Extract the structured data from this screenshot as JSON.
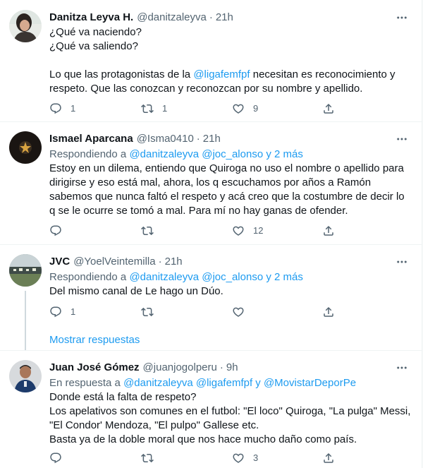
{
  "tweets": [
    {
      "name": "Danitza Leyva H.",
      "handle": "@danitzaleyva",
      "time": "21h",
      "text_pre": "¿Qué va naciendo?\n¿Qué va saliendo?\n\nLo que las protagonistas de la ",
      "text_mention": "@ligafemfpf",
      "text_post": " necesitan es reconocimiento y respeto. Que las conozcan y reconozcan por su nombre y apellido.",
      "replies": "1",
      "retweets": "1",
      "likes": "9"
    },
    {
      "name": "Ismael Aparcana",
      "handle": "@Isma0410",
      "time": "21h",
      "reply_prefix": "Respondiendo a",
      "reply_mentions": "@danitzaleyva @joc_alonso y 2 más",
      "text": "Estoy en un dilema, entiendo que Quiroga no uso el nombre o apellido para dirigirse y eso está mal, ahora, los q escuchamos por años a Ramón sabemos que nunca faltó el respeto y acá creo que la costumbre de decir lo q se le ocurre se tomó a mal. Para mí no hay ganas de ofender.",
      "replies": "",
      "retweets": "",
      "likes": "12"
    },
    {
      "name": "JVC",
      "handle": "@YoelVeintemilla",
      "time": "21h",
      "reply_prefix": "Respondiendo a",
      "reply_mentions": "@danitzaleyva @joc_alonso y 2 más",
      "text": "Del mismo canal de Le hago un Dúo.",
      "replies": "1",
      "retweets": "",
      "likes": ""
    },
    {
      "name": "Juan José Gómez",
      "handle": "@juanjogolperu",
      "time": "9h",
      "reply_prefix": "En respuesta a",
      "reply_mentions": "@danitzaleyva @ligafemfpf y @MovistarDeporPe",
      "text": "Donde está la falta de respeto?\nLos apelativos son comunes en el futbol: \"El loco\" Quiroga, \"La pulga\" Messi, \"El Condor' Mendoza, \"El pulpo\" Gallese etc.\nBasta ya de la doble moral que nos hace mucho daño como país.",
      "replies": "",
      "retweets": "",
      "likes": "3"
    }
  ],
  "show_replies": "Mostrar respuestas",
  "colors": {
    "accent": "#1d9bf0",
    "secondary_text": "#536471",
    "primary_text": "#0f1419",
    "divider": "#eff3f4"
  },
  "icons": [
    "reply-icon",
    "retweet-icon",
    "like-icon",
    "share-icon",
    "more-icon"
  ]
}
